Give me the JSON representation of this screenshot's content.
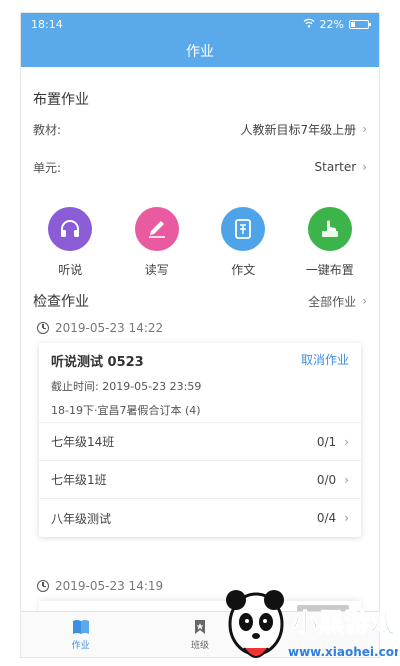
{
  "status_bar": {
    "time": "18:14",
    "battery_text": "22%",
    "battery_level": 0.22
  },
  "nav": {
    "title": "作业"
  },
  "assign": {
    "title": "布置作业",
    "textbook_label": "教材:",
    "textbook_value": "人教新目标7年级上册",
    "unit_label": "单元:",
    "unit_value": "Starter",
    "actions": [
      {
        "label": "听说",
        "icon": "headphones-icon",
        "color": "#8a5cd6"
      },
      {
        "label": "读写",
        "icon": "pencil-icon",
        "color": "#ea5aa0"
      },
      {
        "label": "作文",
        "icon": "composition-icon",
        "color": "#4fa3e8"
      },
      {
        "label": "一键布置",
        "icon": "hand-pointer-icon",
        "color": "#3cb44a"
      }
    ]
  },
  "check": {
    "title": "检查作业",
    "all_link": "全部作业",
    "groups": [
      {
        "timestamp": "2019-05-23 14:22",
        "card": {
          "title": "听说测试 0523",
          "cancel": "取消作业",
          "deadline": "截止时间: 2019-05-23 23:59",
          "book": "18-19下·宜昌7暑假合订本 (4)",
          "classes": [
            {
              "name": "七年级14班",
              "count": "0/1"
            },
            {
              "name": "七年级1班",
              "count": "0/0"
            },
            {
              "name": "八年级测试",
              "count": "0/4"
            }
          ]
        }
      },
      {
        "timestamp": "2019-05-23 14:19"
      }
    ]
  },
  "tab_bar": {
    "tabs": [
      {
        "label": "作业",
        "icon": "book-icon",
        "active": true
      },
      {
        "label": "班级",
        "icon": "bookmark-icon",
        "active": false
      }
    ]
  },
  "watermark": {
    "brand": "小黑游戏",
    "url": "www.xiaohei.com"
  },
  "colors": {
    "accent": "#5aa9ea",
    "link": "#3d8fe0"
  }
}
